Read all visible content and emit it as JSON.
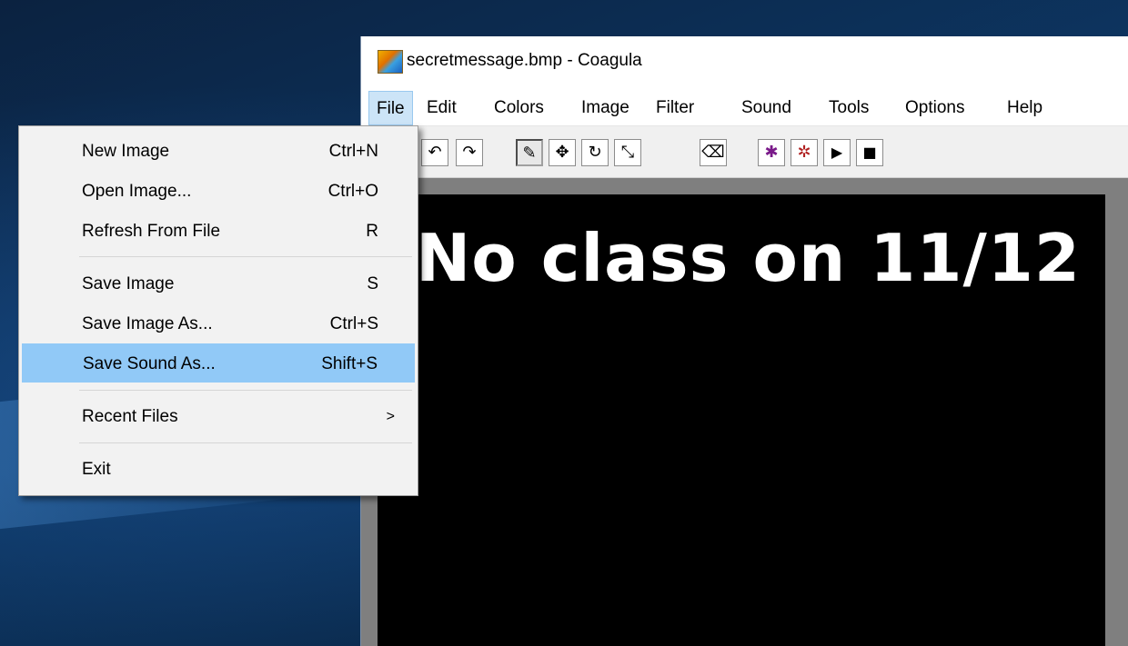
{
  "window": {
    "title": "secretmessage.bmp - Coagula",
    "app_icon": "coagula-app-icon"
  },
  "menubar": {
    "items": [
      {
        "label": "File",
        "active": true
      },
      {
        "label": "Edit"
      },
      {
        "label": "Colors"
      },
      {
        "label": "Image"
      },
      {
        "label": "Filter"
      },
      {
        "label": "Sound"
      },
      {
        "label": "Tools"
      },
      {
        "label": "Options"
      },
      {
        "label": "Help"
      }
    ]
  },
  "toolbar": {
    "buttons": [
      {
        "name": "undo-icon",
        "glyph": "↶"
      },
      {
        "name": "redo-icon",
        "glyph": "↷"
      },
      {
        "name": "brush-icon",
        "glyph": "✎",
        "pressed": true
      },
      {
        "name": "move-icon",
        "glyph": "✥"
      },
      {
        "name": "rotate-icon",
        "glyph": "↻"
      },
      {
        "name": "resize-icon",
        "glyph": "⤡"
      },
      {
        "name": "eraser-icon",
        "glyph": "⌫"
      },
      {
        "name": "render-icon",
        "glyph": "✱"
      },
      {
        "name": "render-selection-icon",
        "glyph": "✲"
      },
      {
        "name": "play-icon",
        "glyph": "▶"
      },
      {
        "name": "stop-icon",
        "glyph": "■"
      }
    ]
  },
  "canvas": {
    "text": "No class on 11/12"
  },
  "file_menu": {
    "items": [
      {
        "label": "New Image",
        "shortcut": "Ctrl+N"
      },
      {
        "label": "Open Image...",
        "shortcut": "Ctrl+O"
      },
      {
        "label": "Refresh From File",
        "shortcut": "R"
      },
      {
        "label": "Save Image",
        "shortcut": "S"
      },
      {
        "label": "Save Image As...",
        "shortcut": "Ctrl+S"
      },
      {
        "label": "Save Sound As...",
        "shortcut": "Shift+S",
        "highlighted": true
      },
      {
        "label": "Recent Files",
        "submenu": true
      },
      {
        "label": "Exit",
        "shortcut": ""
      }
    ]
  },
  "colors": {
    "menu_highlight": "#91c9f7",
    "menubar_active": "#cce4f7",
    "canvas_background": "#000000",
    "canvas_text": "#ffffff"
  }
}
